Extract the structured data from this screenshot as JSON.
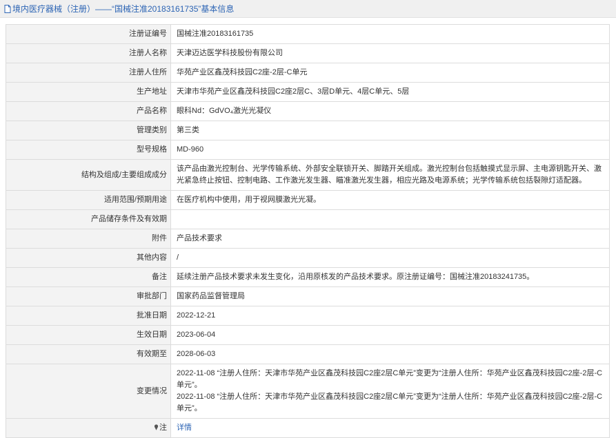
{
  "header": {
    "title": "境内医疗器械（注册）——“国械注准20183161735”基本信息"
  },
  "rows": [
    {
      "label": "注册证编号",
      "value": "国械注准20183161735"
    },
    {
      "label": "注册人名称",
      "value": "天津迈达医学科技股份有限公司"
    },
    {
      "label": "注册人住所",
      "value": "华苑产业区鑫茂科技园C2座-2层-C单元"
    },
    {
      "label": "生产地址",
      "value": "天津市华苑产业区鑫茂科技园C2座2层C、3层D单元、4层C单元、5层"
    },
    {
      "label": "产品名称",
      "value": "眼科Nd：GdVO₄激光光凝仪"
    },
    {
      "label": "管理类别",
      "value": "第三类"
    },
    {
      "label": "型号规格",
      "value": "MD-960"
    },
    {
      "label": "结构及组成/主要组成成分",
      "value": "该产品由激光控制台、光学传输系统、外部安全联锁开关、脚踏开关组成。激光控制台包括触摸式显示屏、主电源钥匙开关、激光紧急终止按钮、控制电路、工作激光发生器、瞄准激光发生器，相应光路及电源系统；光学传输系统包括裂隙灯适配器。"
    },
    {
      "label": "适用范围/预期用途",
      "value": "在医疗机构中使用，用于视网膜激光光凝。"
    },
    {
      "label": "产品储存条件及有效期",
      "value": ""
    },
    {
      "label": "附件",
      "value": "产品技术要求"
    },
    {
      "label": "其他内容",
      "value": "/"
    },
    {
      "label": "备注",
      "value": "延续注册产品技术要求未发生变化，沿用原核发的产品技术要求。原注册证编号：国械注准20183241735。"
    },
    {
      "label": "审批部门",
      "value": "国家药品监督管理局"
    },
    {
      "label": "批准日期",
      "value": "2022-12-21"
    },
    {
      "label": "生效日期",
      "value": "2023-06-04"
    },
    {
      "label": "有效期至",
      "value": "2028-06-03"
    }
  ],
  "changes": {
    "label": "变更情况",
    "entries": [
      "2022-11-08 “注册人住所：天津市华苑产业区鑫茂科技园C2座2层C单元”变更为“注册人住所：华苑产业区鑫茂科技园C2座-2层-C单元”。",
      "2022-11-08 “注册人住所：天津市华苑产业区鑫茂科技园C2座2层C单元”变更为“注册人住所：华苑产业区鑫茂科技园C2座-2层-C单元”。"
    ]
  },
  "note": {
    "label": "注",
    "link": "详情"
  },
  "colors": {
    "link": "#2c64b4",
    "label_bg": "#f3f3f3",
    "border": "#dcdcdc",
    "title_bar_bg": "#f0f0f0"
  },
  "icons": {
    "title": "document-icon",
    "note": "map-pin-icon"
  }
}
